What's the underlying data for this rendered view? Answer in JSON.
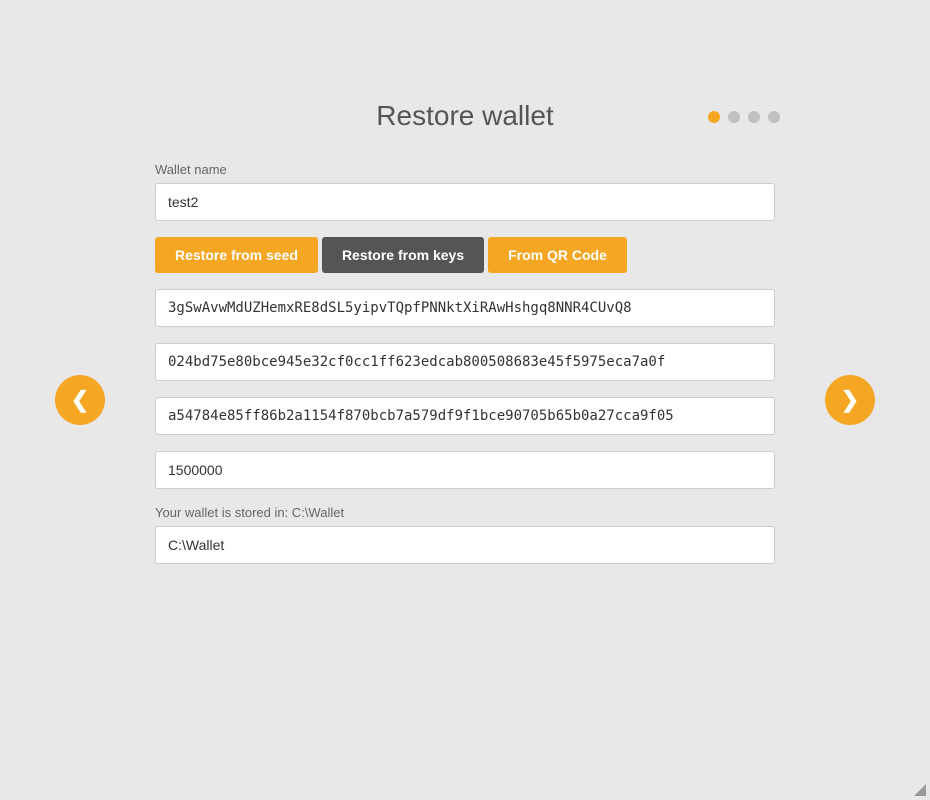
{
  "page": {
    "title": "Restore wallet",
    "background_color": "#e8e8e8"
  },
  "indicator": {
    "dots": [
      {
        "active": true,
        "label": "step-1"
      },
      {
        "active": false,
        "label": "step-2"
      },
      {
        "active": false,
        "label": "step-3"
      },
      {
        "active": false,
        "label": "step-4"
      }
    ]
  },
  "form": {
    "wallet_name_label": "Wallet name",
    "wallet_name_value": "test2",
    "wallet_name_placeholder": "Wallet name",
    "tabs": [
      {
        "label": "Restore from seed",
        "state": "active"
      },
      {
        "label": "Restore from keys",
        "state": "selected"
      },
      {
        "label": "From QR Code",
        "state": "active"
      }
    ],
    "key_field_1": "3gSwAvwMdUZHemxRE8dSL5yipvTQpfPNNktXiRAwHshgq8NNR4CUvQ8",
    "key_field_2": "024bd75e80bce945e32cf0cc1ff623edcab800508683e45f5975eca7a0f",
    "key_field_3": "a54784e85ff86b2a1154f870bcb7a579df9f1bce90705b65b0a27cca9f05",
    "restore_height_value": "1500000",
    "wallet_path_label": "Your wallet is stored in: C:\\Wallet",
    "wallet_path_value": "C:\\Wallet"
  },
  "navigation": {
    "back_label": "❮",
    "forward_label": "❯"
  }
}
